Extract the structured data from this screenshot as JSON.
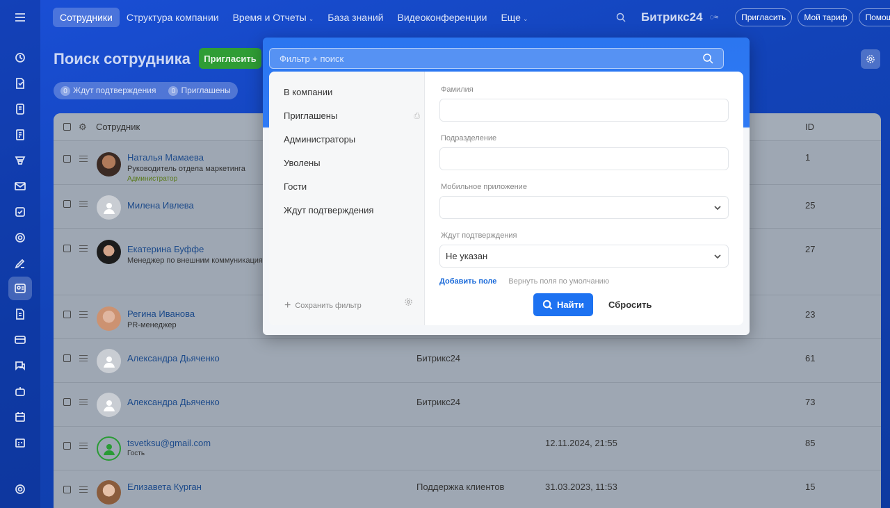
{
  "nav": {
    "tabs": [
      "Сотрудники",
      "Структура компании",
      "Время и Отчеты",
      "База знаний",
      "Видеоконференции",
      "Еще"
    ],
    "brand": "Битрикс24",
    "buttons": [
      "Пригласить",
      "Мой тариф",
      "Помощь"
    ]
  },
  "page": {
    "title": "Поиск сотрудника",
    "invite": "Пригласить",
    "counters": [
      {
        "count": "0",
        "label": "Ждут подтверждения"
      },
      {
        "count": "0",
        "label": "Приглашены"
      }
    ]
  },
  "grid": {
    "columns": {
      "employee": "Сотрудник",
      "id": "ID"
    },
    "rows": [
      {
        "name": "Наталья Мамаева",
        "position": "Руководитель отдела маркетинга",
        "badge": "Администратор",
        "dept": "",
        "date": "",
        "id": "1"
      },
      {
        "name": "Милена Ивлева",
        "position": "",
        "dept": "",
        "date": "",
        "id": "25"
      },
      {
        "name": "Екатерина Буффе",
        "position": "Менеджер по внешним коммуникациям",
        "dept": "",
        "date": "",
        "id": "27"
      },
      {
        "name": "Регина Иванова",
        "position": "PR-менеджер",
        "dept": "",
        "date": "",
        "id": "23"
      },
      {
        "name": "Александра Дьяченко",
        "position": "",
        "dept": "Битрикс24",
        "date": "",
        "id": "61"
      },
      {
        "name": "Александра Дьяченко",
        "position": "",
        "dept": "Битрикс24",
        "date": "",
        "id": "73"
      },
      {
        "name": "tsvetksu@gmail.com",
        "position": "Гость",
        "dept": "",
        "date": "12.11.2024, 21:55",
        "id": "85"
      },
      {
        "name": "Елизавета Курган",
        "position": "",
        "dept": "Поддержка клиентов",
        "date": "31.03.2023, 11:53",
        "id": "15"
      }
    ]
  },
  "filter": {
    "placeholder": "Фильтр + поиск",
    "presets": [
      "В компании",
      "Приглашены",
      "Администраторы",
      "Уволены",
      "Гости",
      "Ждут подтверждения"
    ],
    "save_filter": "Сохранить фильтр",
    "fields": {
      "lastname": {
        "label": "Фамилия",
        "value": ""
      },
      "department": {
        "label": "Подразделение",
        "value": ""
      },
      "mobile_app": {
        "label": "Мобильное приложение",
        "value": ""
      },
      "awaiting": {
        "label": "Ждут подтверждения",
        "value": "Не указан"
      }
    },
    "add_field": "Добавить поле",
    "restore_fields": "Вернуть поля по умолчанию",
    "find": "Найти",
    "reset": "Сбросить"
  }
}
